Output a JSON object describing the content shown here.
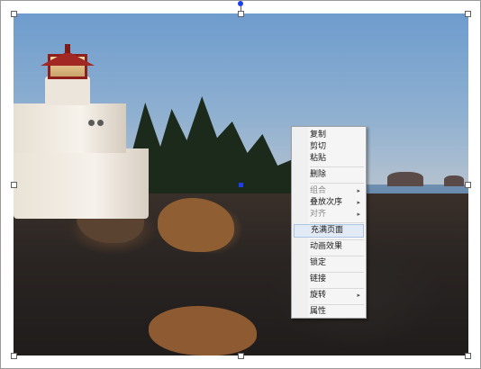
{
  "context_menu": {
    "items": [
      {
        "label": "复制",
        "disabled": false
      },
      {
        "label": "剪切",
        "disabled": false
      },
      {
        "label": "粘贴",
        "disabled": false
      },
      {
        "label": "删除",
        "disabled": false
      },
      {
        "label": "组合",
        "disabled": true,
        "submenu": true
      },
      {
        "label": "叠放次序",
        "disabled": false,
        "submenu": true
      },
      {
        "label": "对齐",
        "disabled": true,
        "submenu": true
      },
      {
        "label": "充满页面",
        "disabled": false,
        "highlighted": true
      },
      {
        "label": "动画效果",
        "disabled": false
      },
      {
        "label": "锁定",
        "disabled": false
      },
      {
        "label": "链接",
        "disabled": false
      },
      {
        "label": "旋转",
        "disabled": false,
        "submenu": true
      },
      {
        "label": "属性",
        "disabled": false
      }
    ],
    "submenu_arrow": "▸"
  },
  "image": {
    "description_icon": "lighthouse-photo"
  },
  "colors": {
    "selection_handle_border": "#606060",
    "rotation_handle": "#1a3ef0",
    "menu_highlight": "#e2eaf5"
  }
}
